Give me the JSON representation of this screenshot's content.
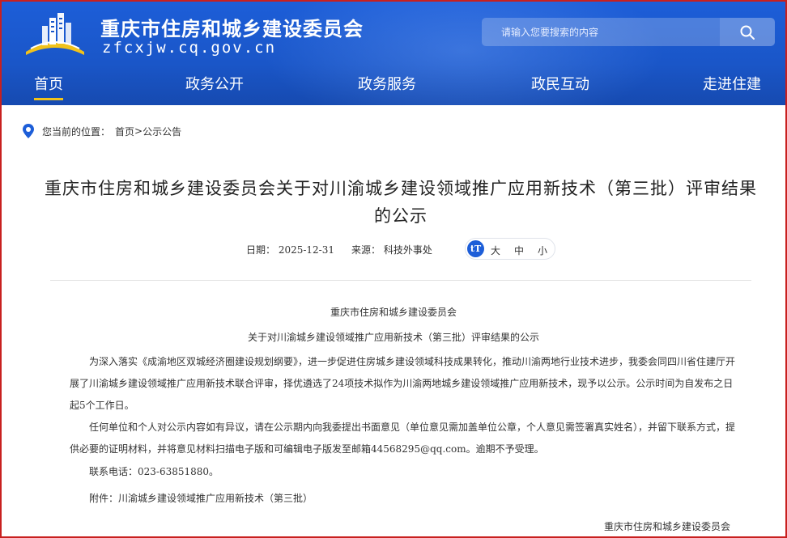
{
  "site": {
    "title": "重庆市住房和城乡建设委员会",
    "domain": "zfcxjw.cq.gov.cn",
    "brand_color": "#1a56c8",
    "accent_color": "#f1c21b"
  },
  "search": {
    "placeholder": "请输入您要搜索的内容",
    "icon": "search-icon"
  },
  "nav": {
    "items": [
      {
        "label": "首页",
        "active": true
      },
      {
        "label": "政务公开",
        "active": false
      },
      {
        "label": "政务服务",
        "active": false
      },
      {
        "label": "政民互动",
        "active": false
      },
      {
        "label": "走进住建",
        "active": false
      }
    ]
  },
  "breadcrumb": {
    "icon": "location-pin-icon",
    "label": "您当前的位置：",
    "home": "首页",
    "separator": ">",
    "current": "公示公告"
  },
  "article": {
    "title": "重庆市住房和城乡建设委员会关于对川渝城乡建设领域推广应用新技术（第三批）评审结果的公示",
    "date": "日期：  2025-12-31",
    "source": "来源：  科技外事处",
    "font_size_icon": "text-size-icon",
    "font_sizes": [
      "大",
      "中",
      "小"
    ],
    "issuer_heading": "重庆市住房和城乡建设委员会",
    "sub_heading": "关于对川渝城乡建设领域推广应用新技术（第三批）评审结果的公示",
    "paragraphs": [
      "为深入落实《成渝地区双城经济圈建设规划纲要》，进一步促进住房城乡建设领域科技成果转化，推动川渝两地行业技术进步，我委会同四川省住建厅开展了川渝城乡建设领域推广应用新技术联合评审，择优遴选了24项技术拟作为川渝两地城乡建设领域推广应用新技术，现予以公示。公示时间为自发布之日起5个工作日。",
      "任何单位和个人对公示内容如有异议，请在公示期内向我委提出书面意见（单位意见需加盖单位公章，个人意见需签署真实姓名），并留下联系方式，提供必要的证明材料，并将意见材料扫描电子版和可编辑电子版发至邮箱44568295@qq.com。逾期不予受理。",
      "联系电话：023-63851880。",
      "附件：川渝城乡建设领域推广应用新技术（第三批）"
    ],
    "signature": "重庆市住房和城乡建设委员会"
  }
}
